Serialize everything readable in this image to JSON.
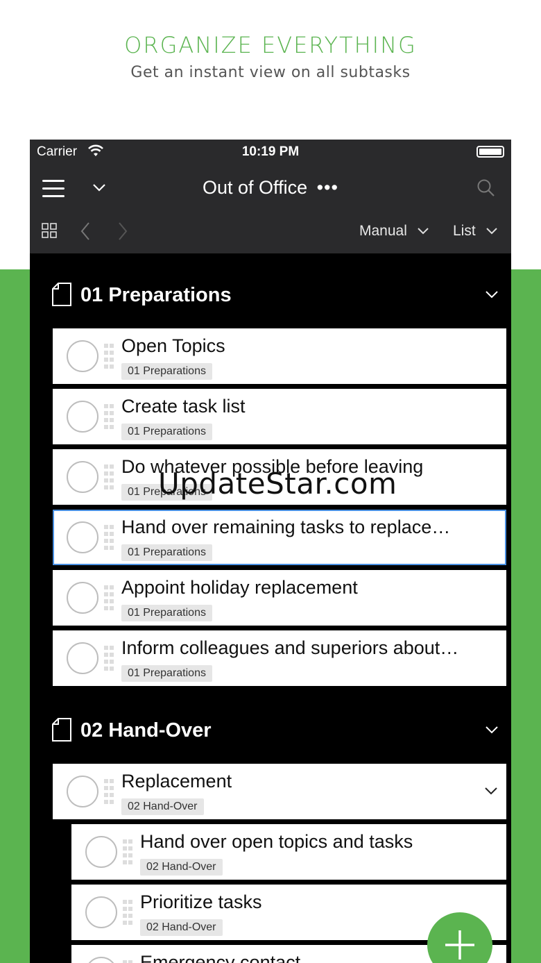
{
  "promo": {
    "title": "ORGANIZE EVERYTHING",
    "subtitle": "Get an instant view on all subtasks"
  },
  "status_bar": {
    "carrier": "Carrier",
    "time": "10:19 PM"
  },
  "nav": {
    "title": "Out of Office",
    "more_glyph": "•••",
    "sort_label": "Manual",
    "view_label": "List"
  },
  "sections": [
    {
      "title": "01 Preparations",
      "tasks": [
        {
          "title": "Open Topics",
          "tag": "01 Preparations"
        },
        {
          "title": "Create task list",
          "tag": "01 Preparations"
        },
        {
          "title": "Do whatever possible before leaving",
          "tag": "01 Preparations"
        },
        {
          "title": "Hand over remaining tasks to replace…",
          "tag": "01 Preparations"
        },
        {
          "title": "Appoint holiday replacement",
          "tag": "01 Preparations"
        },
        {
          "title": "Inform colleagues and superiors about…",
          "tag": "01 Preparations"
        }
      ]
    },
    {
      "title": "02 Hand-Over",
      "tasks": [
        {
          "title": "Replacement",
          "tag": "02 Hand-Over"
        },
        {
          "title": "Hand over open topics and tasks",
          "tag": "02 Hand-Over"
        },
        {
          "title": "Prioritize tasks",
          "tag": "02 Hand-Over"
        },
        {
          "title": "Emergency contact",
          "tag": ""
        }
      ]
    }
  ],
  "watermark": "UpdateStar.com",
  "colors": {
    "brand_green": "#5bb450",
    "nav_bg": "#2a2a2c",
    "selection_blue": "#4a90e2"
  },
  "icons": [
    "menu-icon",
    "chevron-down-icon",
    "more-icon",
    "search-icon",
    "grid-icon",
    "chevron-left-icon",
    "chevron-right-icon",
    "document-icon",
    "drag-handle-icon",
    "plus-icon"
  ]
}
